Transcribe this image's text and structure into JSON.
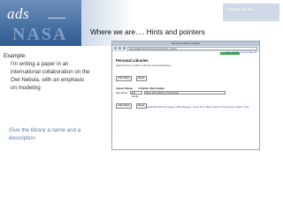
{
  "header": {
    "logo_text": "ads",
    "logo_sub": "NASA",
    "section_tag": "• Where we are…",
    "title": "Where we are…. Hints and pointers"
  },
  "left": {
    "example_label": "Example:",
    "example_desc": "I'm writing a paper in an international collaboration on the Owl Nebula, with an emphasis on modeling",
    "hint": "Give the library a name and a description"
  },
  "browser": {
    "window_title": "Personal Library Update",
    "url": "http://adsabs.harvard.edu/cgi-bin/nph-abs_connect",
    "top_links": "(Sign out) My account Sign-off",
    "library_heading": "Personal Libraries",
    "instruction": "Select library in which to add the selected libraries:",
    "add_button": "Add Library",
    "reset_button": "Reset",
    "col_name": "Library Name",
    "col_desc": "# Entries Description",
    "row_label": "New library:",
    "name_value": "Owl Nebula",
    "desc_value": "Paper and modeling of Owl Nebula",
    "footer_links": "Data/Public ADS Homepage | ADS Manager | Query Form | Basic Search | Preferences | HELP | FAQ"
  }
}
